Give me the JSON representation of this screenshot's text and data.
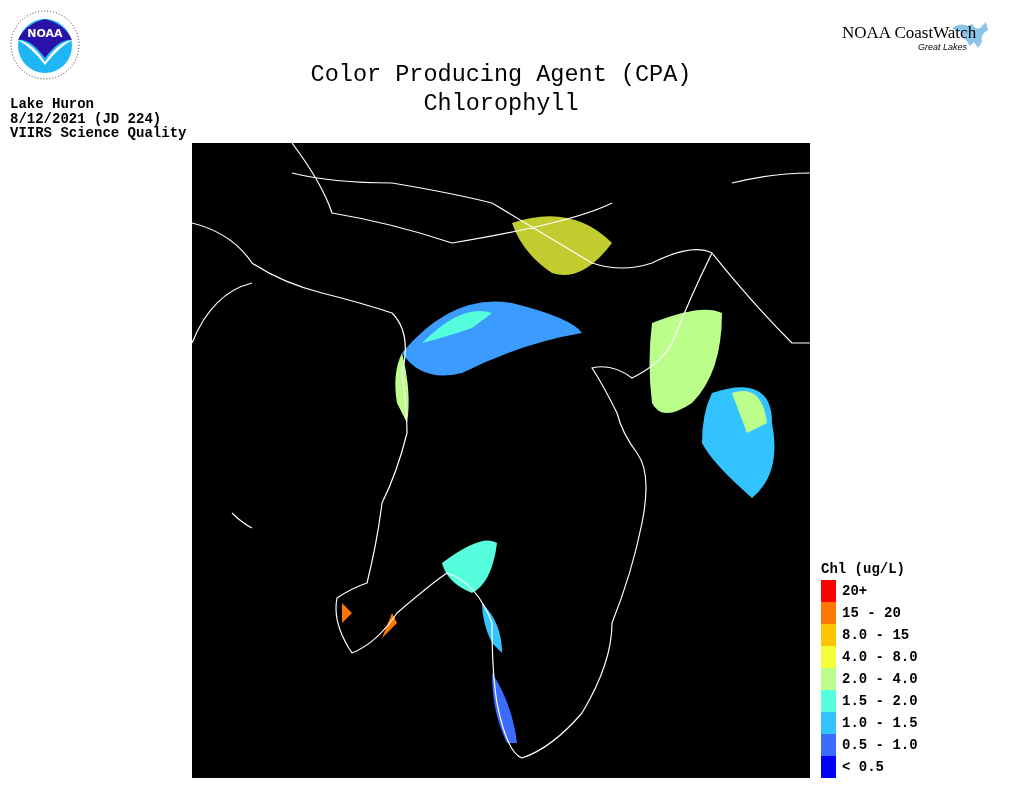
{
  "logos": {
    "agency_badge": "NOAA",
    "brand": "NOAA CoastWatch",
    "brand_sub": "Great Lakes"
  },
  "title": [
    "Color Producing Agent (CPA)",
    "Chlorophyll"
  ],
  "info": [
    "Lake Huron",
    "8/12/2021 (JD 224)",
    "VIIRS Science Quality"
  ],
  "legend": {
    "title": "Chl (ug/L)",
    "items": [
      {
        "label": "20+",
        "color": "#ff0000"
      },
      {
        "label": "15 - 20",
        "color": "#ff7700"
      },
      {
        "label": "8.0 - 15",
        "color": "#ffc400"
      },
      {
        "label": "4.0 - 8.0",
        "color": "#f2ff3a"
      },
      {
        "label": "2.0 - 4.0",
        "color": "#bbff8a"
      },
      {
        "label": "1.5 - 2.0",
        "color": "#55ffdd"
      },
      {
        "label": "1.0 - 1.5",
        "color": "#33c4ff"
      },
      {
        "label": "0.5 - 1.0",
        "color": "#3b6bff"
      },
      {
        "label": "< 0.5",
        "color": "#0000ff"
      }
    ]
  }
}
